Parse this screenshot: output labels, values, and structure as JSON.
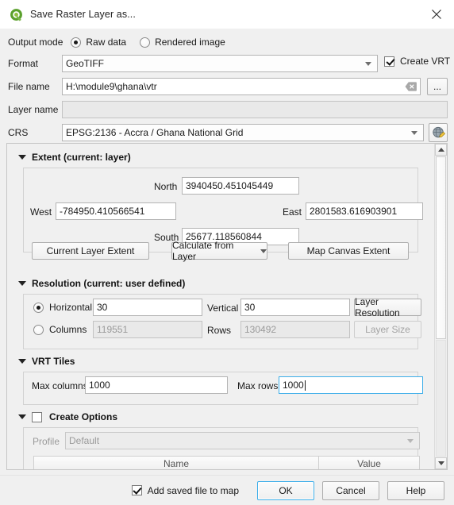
{
  "window": {
    "title": "Save Raster Layer as...",
    "logo_icon": "qgis-logo-icon",
    "close_icon": "close-icon"
  },
  "form": {
    "output_mode": {
      "label": "Output mode",
      "options": [
        {
          "label": "Raw data",
          "checked": true
        },
        {
          "label": "Rendered image",
          "checked": false
        }
      ]
    },
    "format": {
      "label": "Format",
      "value": "GeoTIFF",
      "dropdown_icon": "chevron-down-icon"
    },
    "create_vrt": {
      "label": "Create VRT",
      "checked": true
    },
    "file_name": {
      "label": "File name",
      "value": "H:\\module9\\ghana\\vtr",
      "clear_icon": "clear-icon",
      "browse_label": "..."
    },
    "layer_name": {
      "label": "Layer name",
      "value": "",
      "placeholder": "",
      "disabled": true
    },
    "crs": {
      "label": "CRS",
      "value": "EPSG:2136 - Accra / Ghana National Grid",
      "dropdown_icon": "chevron-down-icon",
      "select_crs_icon": "globe-edit-icon"
    }
  },
  "extent": {
    "title": "Extent (current: layer)",
    "collapse_icon": "triangle-down-icon",
    "north": {
      "label": "North",
      "value": "3940450.451045449"
    },
    "west": {
      "label": "West",
      "value": "-784950.410566541"
    },
    "east": {
      "label": "East",
      "value": "2801583.616903901"
    },
    "south": {
      "label": "South",
      "value": "25677.118560844"
    },
    "buttons": {
      "current_layer_extent": "Current Layer Extent",
      "calculate_from_layer": "Calculate from Layer",
      "map_canvas_extent": "Map Canvas Extent"
    }
  },
  "resolution": {
    "title": "Resolution (current: user defined)",
    "collapse_icon": "triangle-down-icon",
    "horizontal": {
      "label": "Horizontal",
      "value": "30",
      "checked": true
    },
    "vertical": {
      "label": "Vertical",
      "value": "30"
    },
    "columns": {
      "label": "Columns",
      "value": "119551",
      "checked": false,
      "disabled": true
    },
    "rows": {
      "label": "Rows",
      "value": "130492",
      "disabled": true
    },
    "layer_resolution_button": "Layer Resolution",
    "layer_size_button": "Layer Size"
  },
  "vrt_tiles": {
    "title": "VRT Tiles",
    "collapse_icon": "triangle-down-icon",
    "max_columns": {
      "label": "Max columns",
      "value": "1000"
    },
    "max_rows": {
      "label": "Max rows",
      "value": "1000",
      "focused": true
    }
  },
  "create_options": {
    "title": "Create Options",
    "collapse_icon": "triangle-down-icon",
    "checked": false,
    "profile": {
      "label": "Profile",
      "value": "Default",
      "disabled": true
    },
    "table": {
      "columns": [
        "Name",
        "Value"
      ]
    }
  },
  "footer": {
    "add_saved_file": {
      "label": "Add saved file to map",
      "checked": true
    },
    "ok": "OK",
    "cancel": "Cancel",
    "help": "Help"
  },
  "scrollbar": {
    "up_icon": "scroll-up-arrow-icon",
    "down_icon": "scroll-down-arrow-icon",
    "thumb": "scroll-thumb"
  },
  "colors": {
    "accent": "#3daee9",
    "logo_green": "#589632",
    "dialog_bg": "#f0f0f0"
  }
}
